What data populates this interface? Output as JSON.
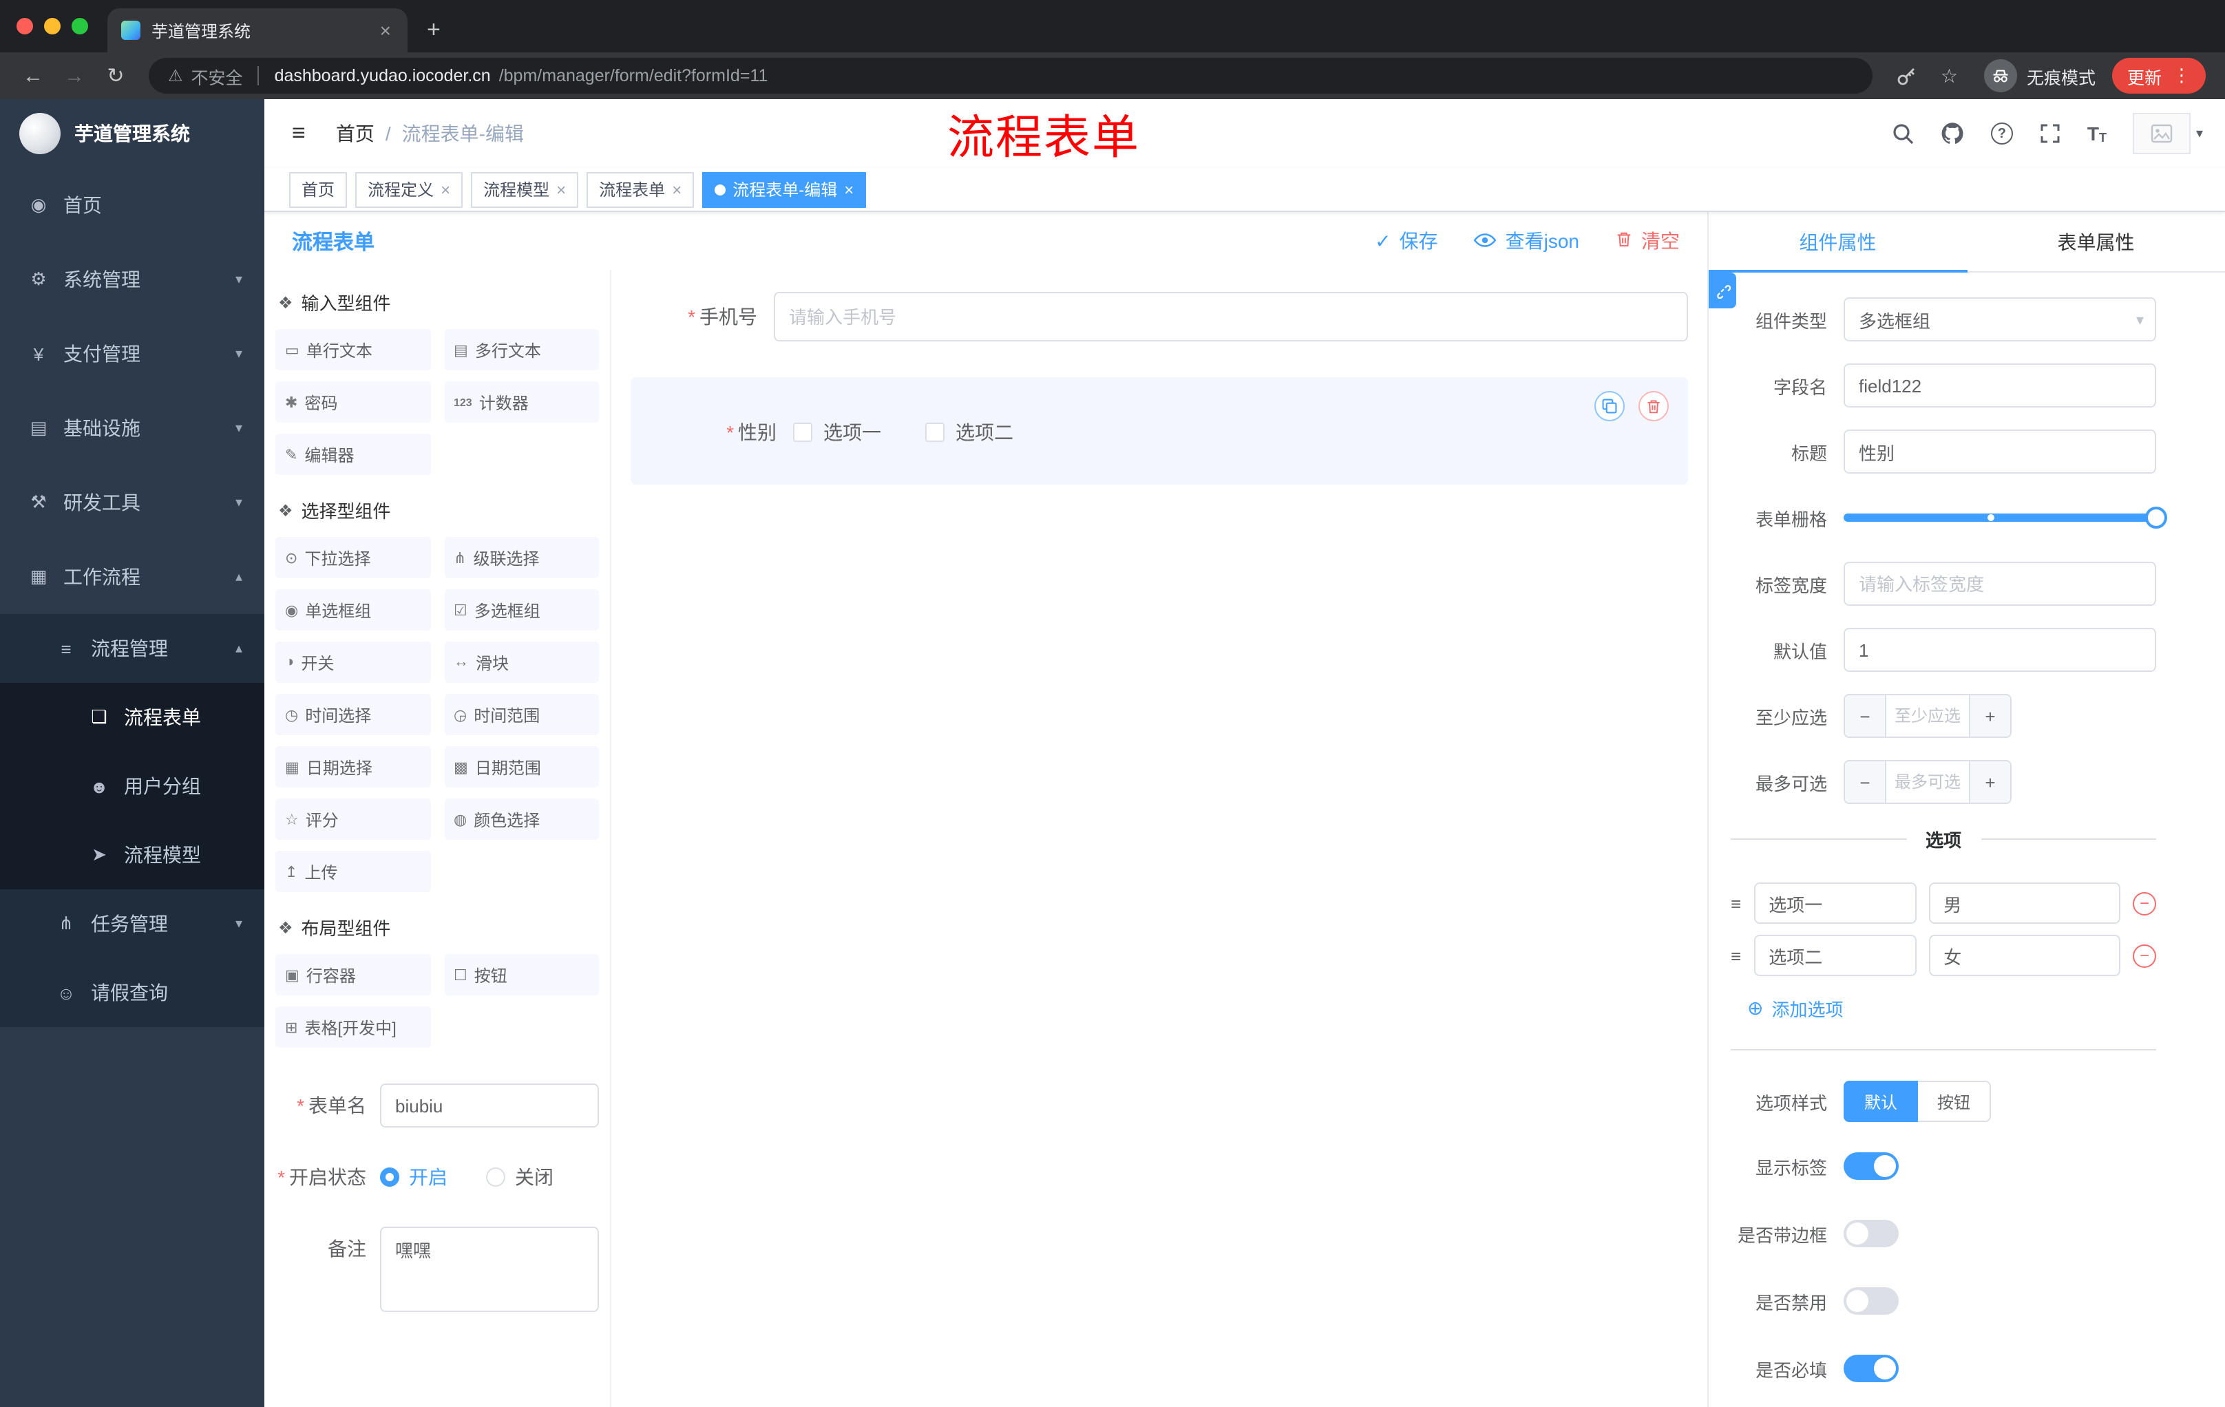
{
  "icons": {
    "close": "×",
    "plus": "+",
    "back": "←",
    "forward": "→",
    "reload": "↻",
    "warning": "⚠",
    "star": "☆",
    "dots": "⋮",
    "hamburger": "≡",
    "breadcrumb_sep": "/",
    "caret": "▾",
    "check": "✓",
    "required": "*",
    "remove": "−",
    "minus": "−",
    "plus_sign": "+",
    "add_circle": "⊕",
    "question": "?",
    "font_large": "T",
    "font_small": "T",
    "handle": "≡"
  },
  "browser": {
    "tab_title": "芋道管理系统",
    "security_text": "不安全",
    "url_host": "dashboard.yudao.iocoder.cn",
    "url_path": "/bpm/manager/form/edit?formId=11",
    "incognito_label": "无痕模式",
    "update_label": "更新"
  },
  "sidebar": {
    "app_title": "芋道管理系统",
    "items": [
      {
        "icon": "◉",
        "label": "首页",
        "chevron": ""
      },
      {
        "icon": "⚙",
        "label": "系统管理",
        "chevron": "▾"
      },
      {
        "icon": "¥",
        "label": "支付管理",
        "chevron": "▾"
      },
      {
        "icon": "▤",
        "label": "基础设施",
        "chevron": "▾"
      },
      {
        "icon": "⚒",
        "label": "研发工具",
        "chevron": "▾"
      },
      {
        "icon": "▦",
        "label": "工作流程",
        "chevron": "▴"
      },
      {
        "icon": "≡",
        "label": "流程管理",
        "chevron": "▴"
      },
      {
        "icon": "❏",
        "label": "流程表单",
        "chevron": ""
      },
      {
        "icon": "☻",
        "label": "用户分组",
        "chevron": ""
      },
      {
        "icon": "➤",
        "label": "流程模型",
        "chevron": ""
      },
      {
        "icon": "⋔",
        "label": "任务管理",
        "chevron": "▾"
      },
      {
        "icon": "☺",
        "label": "请假查询",
        "chevron": ""
      }
    ]
  },
  "header": {
    "breadcrumb_home": "首页",
    "breadcrumb_current": "流程表单-编辑",
    "annotation": "流程表单"
  },
  "tags": [
    {
      "label": "首页"
    },
    {
      "label": "流程定义"
    },
    {
      "label": "流程模型"
    },
    {
      "label": "流程表单"
    },
    {
      "label": "流程表单-编辑"
    }
  ],
  "designer": {
    "title": "流程表单",
    "save_label": "保存",
    "view_json_label": "查看json",
    "clear_label": "清空",
    "groups": [
      {
        "title": "输入型组件",
        "items": [
          {
            "icon": "▭",
            "label": "单行文本"
          },
          {
            "icon": "▤",
            "label": "多行文本"
          },
          {
            "icon": "✱",
            "label": "密码"
          },
          {
            "icon": "123",
            "label": "计数器"
          },
          {
            "icon": "✎",
            "label": "编辑器"
          }
        ]
      },
      {
        "title": "选择型组件",
        "items": [
          {
            "icon": "⊙",
            "label": "下拉选择"
          },
          {
            "icon": "⋔",
            "label": "级联选择"
          },
          {
            "icon": "◉",
            "label": "单选框组"
          },
          {
            "icon": "☑",
            "label": "多选框组"
          },
          {
            "icon": "◑",
            "label": "开关"
          },
          {
            "icon": "↔",
            "label": "滑块"
          },
          {
            "icon": "◷",
            "label": "时间选择"
          },
          {
            "icon": "◶",
            "label": "时间范围"
          },
          {
            "icon": "▦",
            "label": "日期选择"
          },
          {
            "icon": "▩",
            "label": "日期范围"
          },
          {
            "icon": "☆",
            "label": "评分"
          },
          {
            "icon": "◍",
            "label": "颜色选择"
          },
          {
            "icon": "↥",
            "label": "上传"
          }
        ]
      },
      {
        "title": "布局型组件",
        "items": [
          {
            "icon": "▣",
            "label": "行容器"
          },
          {
            "icon": "☐",
            "label": "按钮"
          },
          {
            "icon": "⊞",
            "label": "表格[开发中]"
          }
        ]
      }
    ],
    "form_meta": {
      "name_label": "表单名",
      "name_value": "biubiu",
      "status_label": "开启状态",
      "status_on": "开启",
      "status_off": "关闭",
      "remark_label": "备注",
      "remark_value": "嘿嘿"
    },
    "canvas": {
      "phone_label": "手机号",
      "phone_placeholder": "请输入手机号",
      "gender_label": "性别",
      "gender_option1": "选项一",
      "gender_option2": "选项二"
    }
  },
  "props": {
    "tab_component": "组件属性",
    "tab_form": "表单属性",
    "type_label": "组件类型",
    "type_value": "多选框组",
    "field_label": "字段名",
    "field_value": "field122",
    "title_label": "标题",
    "title_value": "性别",
    "grid_label": "表单栅格",
    "label_width_label": "标签宽度",
    "label_width_placeholder": "请输入标签宽度",
    "default_label": "默认值",
    "default_value": "1",
    "min_label": "至少应选",
    "min_placeholder": "至少应选",
    "max_label": "最多可选",
    "max_placeholder": "最多可选",
    "options_title": "选项",
    "options": [
      {
        "name": "选项一",
        "value": "男"
      },
      {
        "name": "选项二",
        "value": "女"
      }
    ],
    "add_option_label": "添加选项",
    "style_label": "选项样式",
    "style_default": "默认",
    "style_button": "按钮",
    "show_label_label": "显示标签",
    "border_label": "是否带边框",
    "disabled_label": "是否禁用",
    "required_label": "是否必填"
  }
}
